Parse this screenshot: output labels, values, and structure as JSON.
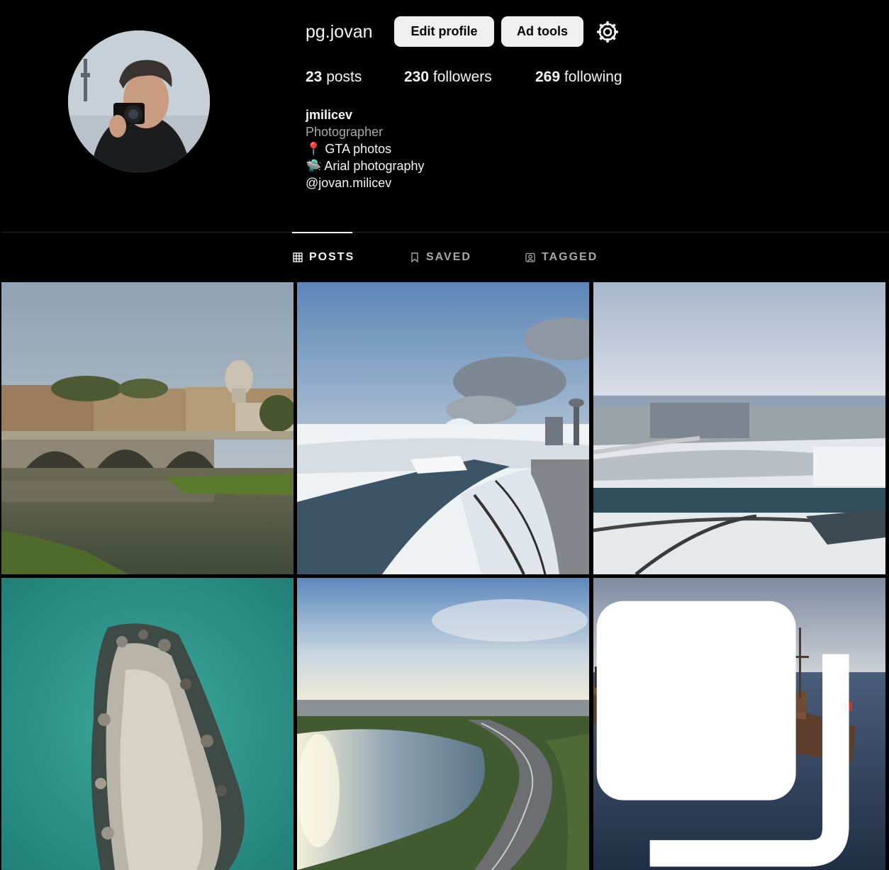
{
  "profile": {
    "username": "pg.jovan",
    "edit_label": "Edit profile",
    "ad_tools_label": "Ad tools",
    "settings_icon": "settings-icon"
  },
  "stats": {
    "posts": {
      "count": "23",
      "label": "posts"
    },
    "followers": {
      "count": "230",
      "label": "followers"
    },
    "following": {
      "count": "269",
      "label": "following"
    }
  },
  "bio": {
    "name": "jmilicev",
    "category": "Photographer",
    "line1": "📍 GTA photos",
    "line2": "🛸 Arial photography",
    "mention": "@jovan.milicev"
  },
  "tabs": [
    {
      "label": "POSTS",
      "icon": "grid-icon",
      "active": true
    },
    {
      "label": "SAVED",
      "icon": "bookmark-icon",
      "active": false
    },
    {
      "label": "TAGGED",
      "icon": "tagged-icon",
      "active": false
    }
  ],
  "posts": [
    {
      "subject": "rome-bridge-photo"
    },
    {
      "subject": "niagara-falls-winter-photo"
    },
    {
      "subject": "niagara-aerial-photo"
    },
    {
      "subject": "rock-pier-aerial-photo"
    },
    {
      "subject": "highway-lake-aerial-photo"
    },
    {
      "subject": "shipwreck-lake-photo",
      "multiple": true
    }
  ]
}
